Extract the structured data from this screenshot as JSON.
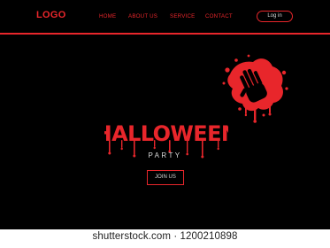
{
  "colors": {
    "background": "#000000",
    "accent": "#e8262b",
    "text_light": "#d9d9d9"
  },
  "header": {
    "logo": "LOGO",
    "nav": [
      {
        "label": "HOME"
      },
      {
        "label": "ABOUT US"
      },
      {
        "label": "SERVICE"
      },
      {
        "label": "CONTACT"
      }
    ],
    "login_label": "Log in"
  },
  "hero": {
    "title": "HALLOWEEN",
    "subtitle": "PARTY",
    "cta_label": "JOIN US",
    "decoration": "blood-splatter-hand-icon"
  },
  "watermark": {
    "text": "shutterstock.com · 1200210898"
  }
}
